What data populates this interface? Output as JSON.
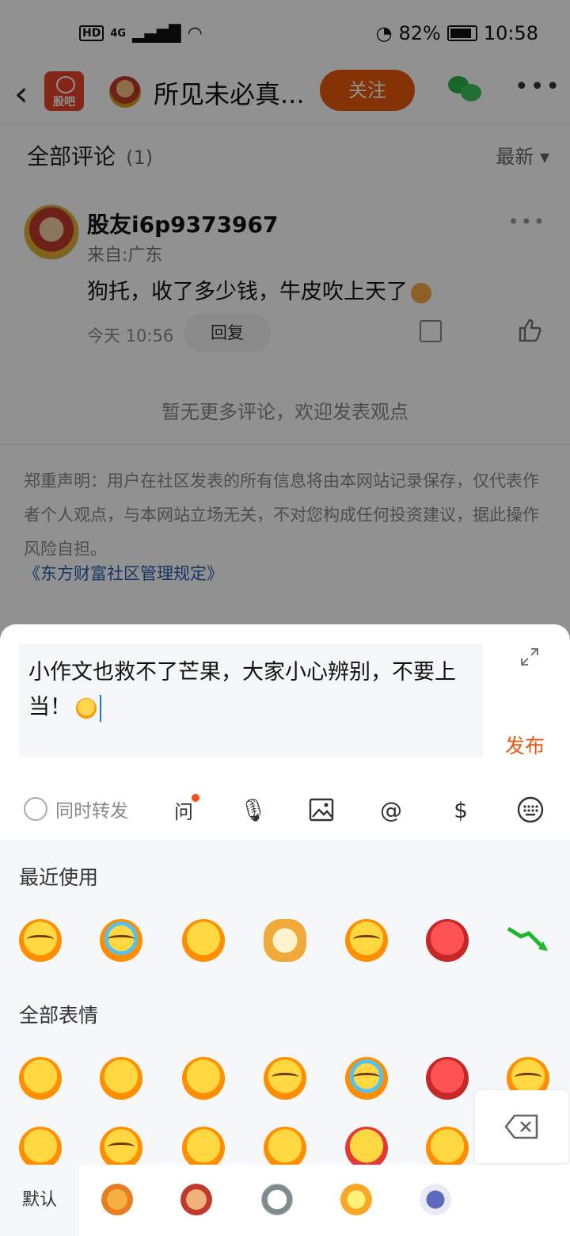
{
  "status_bar": {
    "left_badges": [
      "HD",
      "4G"
    ],
    "battery": "82%",
    "time": "10:58"
  },
  "nav": {
    "back_icon": "chevron-left-icon",
    "app_logo_text": "股吧",
    "title": "所见未必真...",
    "follow_label": "关注",
    "share_icon": "wechat-icon",
    "more_icon": "more-dots-icon"
  },
  "comments_section": {
    "title": "全部评论",
    "count": "(1)",
    "sort_label": "最新 ▾"
  },
  "comment": {
    "user": "股友i6p9373967",
    "from": "来自:广东",
    "text": "狗托，收了多少钱，牛皮吹上天了",
    "time": "今天 10:56",
    "reply_label": "回复"
  },
  "no_more": "暂无更多评论，欢迎发表观点",
  "disclaimer": "郑重声明：用户在社区发表的所有信息将由本网站记录保存，仅代表作者个人观点，与本网站立场无关，不对您构成任何投资建议，据此操作风险自担。",
  "rules_link": "《东方财富社区管理规定》",
  "composer": {
    "text": "小作文也救不了芒果，大家小心辨别，不要上当！",
    "publish_label": "发布",
    "repost_label": "同时转发",
    "tools": [
      "ai-question-icon",
      "voice-input-icon",
      "image-icon",
      "at-icon",
      "dollar-icon",
      "keyboard-icon"
    ]
  },
  "emoji_panel": {
    "recent_label": "最近使用",
    "all_label": "全部表情",
    "default_tab": "默认"
  },
  "colors": {
    "accent": "#e8580c",
    "link": "#2a5db0",
    "wechat": "#2bb34a"
  }
}
